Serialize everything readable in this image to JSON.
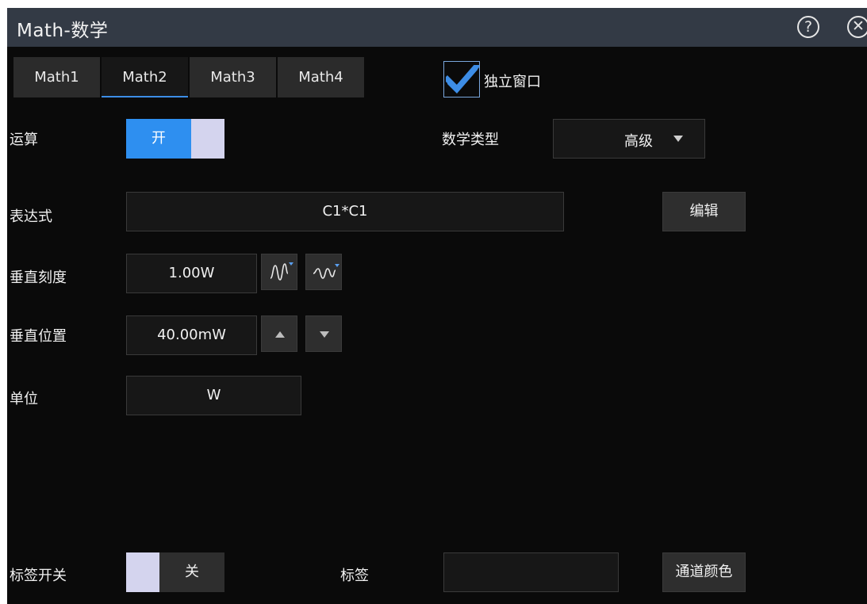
{
  "window": {
    "title": "Math-数学"
  },
  "titlebar": {
    "help_icon": "question-circle-icon",
    "help_glyph": "?",
    "close_icon": "close-circle-icon",
    "close_glyph": "✕"
  },
  "tabs": [
    {
      "label": "Math1",
      "active": false
    },
    {
      "label": "Math2",
      "active": true
    },
    {
      "label": "Math3",
      "active": false
    },
    {
      "label": "Math4",
      "active": false
    }
  ],
  "independent_window": {
    "label": "独立窗口",
    "checked": true
  },
  "operation": {
    "label": "运算",
    "toggle_label": "开",
    "state": "on"
  },
  "math_type": {
    "label": "数学类型",
    "value": "高级"
  },
  "expression": {
    "label": "表达式",
    "value": "C1*C1",
    "edit_label": "编辑"
  },
  "vertical_scale": {
    "label": "垂直刻度",
    "value": "1.00W",
    "coarse_icon": "wave-coarse-icon",
    "fine_icon": "wave-fine-icon"
  },
  "vertical_position": {
    "label": "垂直位置",
    "value": "40.00mW",
    "up_icon": "triangle-up-icon",
    "down_icon": "triangle-down-icon"
  },
  "unit": {
    "label": "单位",
    "value": "W"
  },
  "label_switch": {
    "label": "标签开关",
    "toggle_label": "关",
    "state": "off"
  },
  "label_field": {
    "label": "标签",
    "value": ""
  },
  "channel_color": {
    "label": "通道颜色"
  },
  "colors": {
    "accent": "#2e8ff0",
    "titlebar": "#333a45",
    "background": "#0a0a0a",
    "knob": "#d4d4ee"
  }
}
